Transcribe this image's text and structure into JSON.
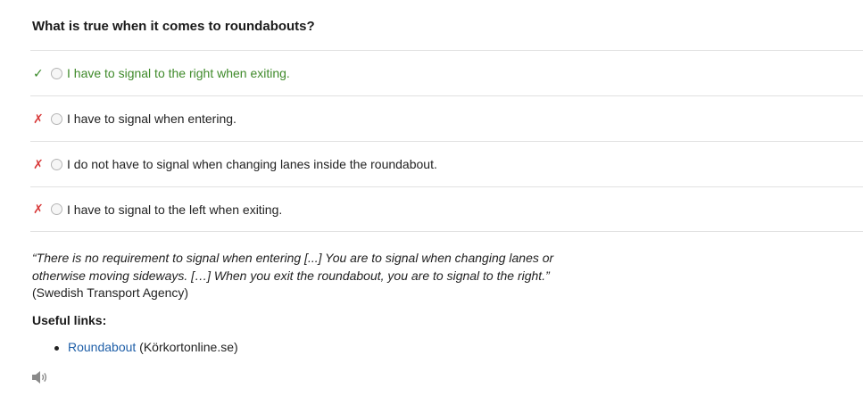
{
  "question": {
    "title": "What is true when it comes to roundabouts?"
  },
  "answers": [
    {
      "mark": "✓",
      "status": "correct",
      "text": "I have to signal to the right when exiting."
    },
    {
      "mark": "✗",
      "status": "wrong",
      "text": "I have to signal when entering."
    },
    {
      "mark": "✗",
      "status": "wrong",
      "text": "I do not have to signal when changing lanes inside the roundabout."
    },
    {
      "mark": "✗",
      "status": "wrong",
      "text": "I have to signal to the left when exiting."
    }
  ],
  "explanation": {
    "quote": "“There is no requirement to signal when entering [...] You are to signal when changing lanes or otherwise moving sideways. […] When you exit the roundabout, you are to signal to the right.”",
    "source": "(Swedish Transport Agency)"
  },
  "useful_links": {
    "heading": "Useful links:",
    "items": [
      {
        "link_text": "Roundabout",
        "suffix": " (Körkortonline.se)"
      }
    ]
  },
  "audio": {
    "icon": "speaker-icon"
  },
  "colors": {
    "correct": "#3a8a2a",
    "wrong": "#d83a3a",
    "link": "#1f5fa8",
    "divider": "#e1e1e1"
  }
}
